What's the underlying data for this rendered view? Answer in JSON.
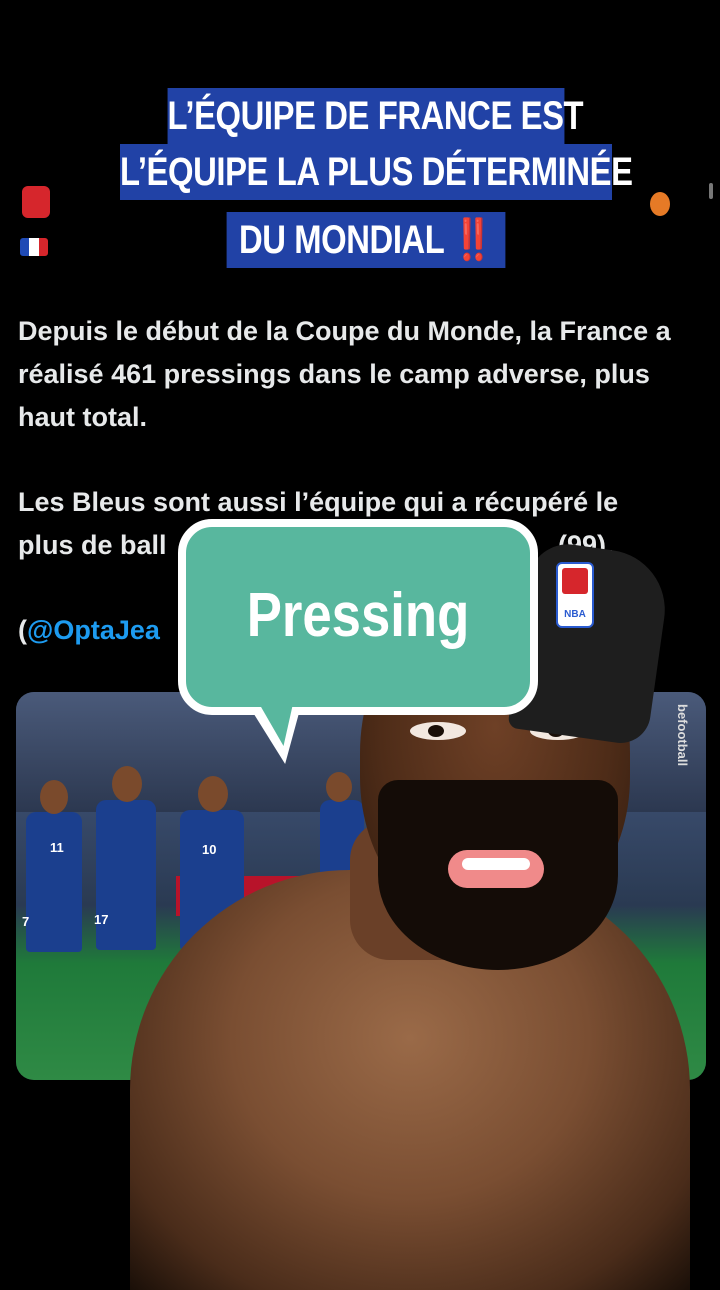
{
  "header": {
    "title_line1": "L’ÉQUIPE DE FRANCE EST",
    "title_line2": "L’ÉQUIPE LA PLUS DÉTERMINÉE",
    "title_line3": "DU MONDIAL",
    "title_emoji": "‼️",
    "bg_color": "#2142a6"
  },
  "tweet": {
    "paragraph1": "Depuis le début de la Coupe du Monde, la France a réalisé 461 pressings dans le camp adverse, plus haut total.",
    "paragraph2_part1": "Les Bleus sont aussi l’équipe qui a récupéré le",
    "paragraph2_part2_start": "plus de ball",
    "paragraph2_part2_end": "(99).",
    "mention_start": "(",
    "mention": "@OptaJea",
    "flag_icon": "france-flag-icon"
  },
  "photo": {
    "watermark": "befootball",
    "jersey_numbers": [
      "11",
      "10",
      "7",
      "17",
      "10"
    ]
  },
  "overlay": {
    "bubble_text": "Pressing",
    "bubble_color": "#58b79e",
    "cap_logo_text": "NBA"
  }
}
